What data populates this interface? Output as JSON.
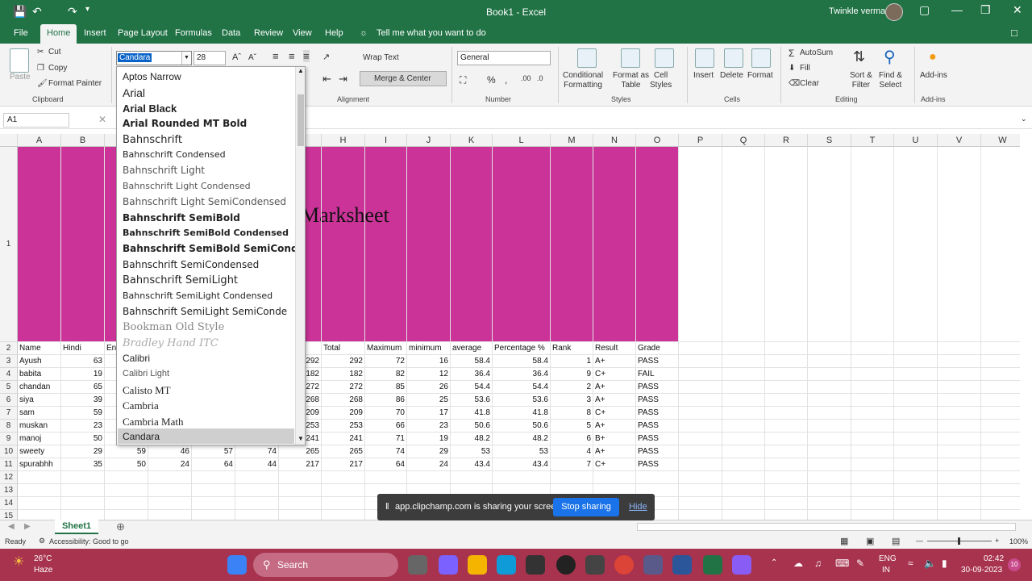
{
  "titlebar": {
    "title": "Book1 - Excel",
    "user": "Twinkle verma"
  },
  "menu": [
    "File",
    "Home",
    "Insert",
    "Page Layout",
    "Formulas",
    "Data",
    "Review",
    "View",
    "Help"
  ],
  "tell_me": "Tell me what you want to do",
  "ribbon": {
    "clipboard": {
      "paste": "Paste",
      "cut": "Cut",
      "copy": "Copy",
      "format_painter": "Format Painter",
      "label": "Clipboard"
    },
    "font": {
      "name": "Candara",
      "size": "28"
    },
    "alignment": {
      "wrap": "Wrap Text",
      "merge": "Merge & Center",
      "label": "Alignment"
    },
    "number": {
      "format": "General",
      "label": "Number"
    },
    "styles": {
      "conditional": "Conditional\nFormatting",
      "format_as": "Format as\nTable",
      "cell_styles": "Cell\nStyles",
      "label": "Styles"
    },
    "cells": {
      "insert": "Insert",
      "delete": "Delete",
      "format": "Format",
      "label": "Cells"
    },
    "editing": {
      "autosum": "AutoSum",
      "fill": "Fill",
      "clear": "Clear",
      "sort": "Sort &\nFilter",
      "find": "Find &\nSelect",
      "label": "Editing"
    },
    "addins": {
      "addins": "Add-ins",
      "label": "Add-ins"
    }
  },
  "namebox": "A1",
  "columns": [
    "A",
    "B",
    "C",
    "D",
    "E",
    "F",
    "G",
    "H",
    "I",
    "J",
    "K",
    "L",
    "M",
    "N",
    "O",
    "P",
    "Q",
    "R",
    "S",
    "T",
    "U",
    "V",
    "W"
  ],
  "rows": [
    "1",
    "2",
    "3",
    "4",
    "5",
    "6",
    "7",
    "8",
    "9",
    "10",
    "11",
    "12",
    "13",
    "14",
    "15"
  ],
  "title_cell": "Marksheet",
  "headers": {
    "name": "Name",
    "hindi": "Hindi",
    "english": "En",
    "total": "Total",
    "max": "Maximum",
    "min": "minimum",
    "avg": "average",
    "pct": "Percentage %",
    "rank": "Rank",
    "result": "Result",
    "grade": "Grade"
  },
  "students": [
    {
      "name": "Ayush",
      "hindi": "63",
      "g": "292",
      "total": "292",
      "max": "72",
      "min": "16",
      "avg": "58.4",
      "pct": "58.4",
      "rank": "1",
      "result": "A+",
      "grade": "PASS"
    },
    {
      "name": "babita",
      "hindi": "19",
      "g": "182",
      "total": "182",
      "max": "82",
      "min": "12",
      "avg": "36.4",
      "pct": "36.4",
      "rank": "9",
      "result": "C+",
      "grade": "FAIL"
    },
    {
      "name": "chandan",
      "hindi": "65",
      "g": "272",
      "total": "272",
      "max": "85",
      "min": "26",
      "avg": "54.4",
      "pct": "54.4",
      "rank": "2",
      "result": "A+",
      "grade": "PASS"
    },
    {
      "name": "siya",
      "hindi": "39",
      "g": "268",
      "total": "268",
      "max": "86",
      "min": "25",
      "avg": "53.6",
      "pct": "53.6",
      "rank": "3",
      "result": "A+",
      "grade": "PASS"
    },
    {
      "name": "sam",
      "hindi": "59",
      "g": "209",
      "total": "209",
      "max": "70",
      "min": "17",
      "avg": "41.8",
      "pct": "41.8",
      "rank": "8",
      "result": "C+",
      "grade": "PASS"
    },
    {
      "name": "muskan",
      "hindi": "23",
      "g": "253",
      "total": "253",
      "max": "66",
      "min": "23",
      "avg": "50.6",
      "pct": "50.6",
      "rank": "5",
      "result": "A+",
      "grade": "PASS"
    },
    {
      "name": "manoj",
      "hindi": "50",
      "g": "241",
      "total": "241",
      "max": "71",
      "min": "19",
      "avg": "48.2",
      "pct": "48.2",
      "rank": "6",
      "result": "B+",
      "grade": "PASS"
    },
    {
      "name": "sweety",
      "hindi": "29",
      "c": "59",
      "d": "46",
      "e": "57",
      "f": "74",
      "g": "265",
      "total": "265",
      "max": "74",
      "min": "29",
      "avg": "53",
      "pct": "53",
      "rank": "4",
      "result": "A+",
      "grade": "PASS"
    },
    {
      "name": "spurabhh",
      "hindi": "35",
      "c": "50",
      "d": "24",
      "e": "64",
      "f": "44",
      "g": "217",
      "total": "217",
      "max": "64",
      "min": "24",
      "avg": "43.4",
      "pct": "43.4",
      "rank": "7",
      "result": "C+",
      "grade": "PASS"
    }
  ],
  "fonts": [
    "Aptos Narrow",
    "Arial",
    "Arial Black",
    "Arial Rounded MT Bold",
    "Bahnschrift",
    "Bahnschrift Condensed",
    "Bahnschrift Light",
    "Bahnschrift Light Condensed",
    "Bahnschrift Light SemiCondensed",
    "Bahnschrift SemiBold",
    "Bahnschrift SemiBold Condensed",
    "Bahnschrift SemiBold SemiConden",
    "Bahnschrift SemiCondensed",
    "Bahnschrift SemiLight",
    "Bahnschrift SemiLight Condensed",
    "Bahnschrift SemiLight SemiConde",
    "Bookman Old Style",
    "Bradley Hand ITC",
    "Calibri",
    "Calibri Light",
    "Calisto MT",
    "Cambria",
    "Cambria Math",
    "Candara"
  ],
  "sheet_tab": "Sheet1",
  "status": {
    "ready": "Ready",
    "accessibility": "Accessibility: Good to go",
    "zoom": "100%"
  },
  "share": {
    "message": "app.clipchamp.com is sharing your screen.",
    "stop": "Stop sharing",
    "hide": "Hide"
  },
  "taskbar": {
    "temp": "26°C",
    "weather": "Haze",
    "search": "Search",
    "lang1": "ENG",
    "lang2": "IN",
    "time": "02:42",
    "date": "30-09-2023"
  },
  "colors": {
    "excel_green": "#217346",
    "title_fill": "#cc3399",
    "taskbar": "#a8334e"
  }
}
